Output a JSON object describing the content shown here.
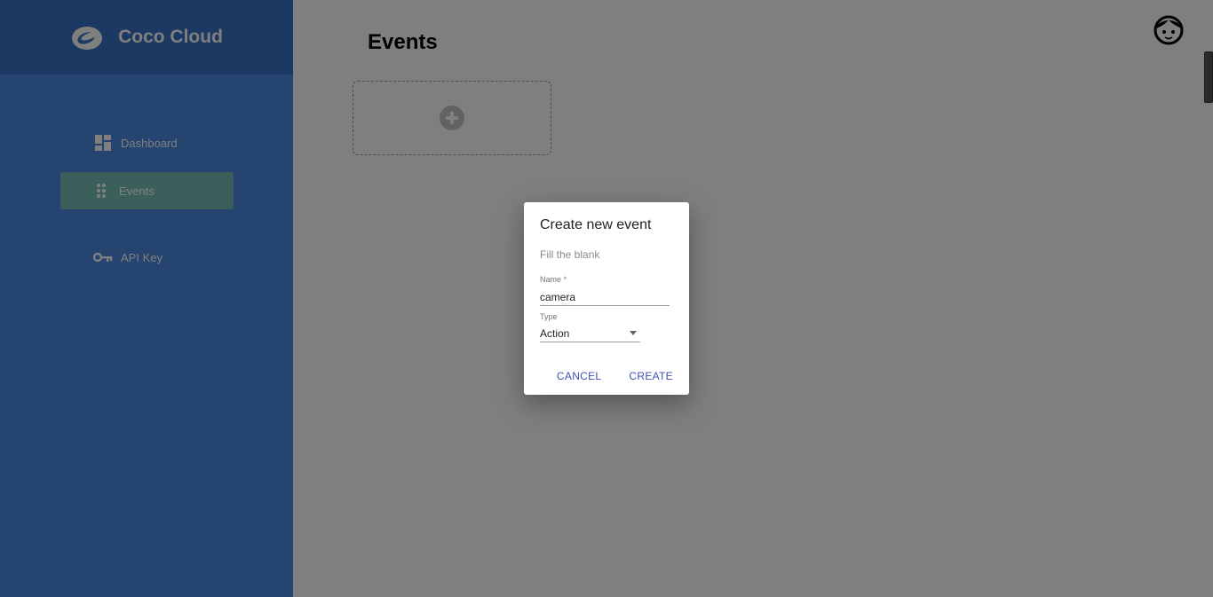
{
  "sidebar": {
    "brand": "Coco Cloud",
    "logo_icon": "cloud-logo-icon",
    "items": [
      {
        "label": "Dashboard",
        "icon": "dashboard-icon",
        "active": false
      },
      {
        "label": "Events",
        "icon": "drag-dots-icon",
        "active": true
      },
      {
        "label": "API Key",
        "icon": "key-icon",
        "active": false
      }
    ]
  },
  "main": {
    "title": "Events",
    "add_card_icon": "plus-circle-icon",
    "avatar_icon": "user-avatar-icon"
  },
  "dialog": {
    "title": "Create new event",
    "subtitle": "Fill the blank",
    "name_label": "Name *",
    "name_value": "camera",
    "type_label": "Type",
    "type_value": "Action",
    "cancel_label": "CANCEL",
    "create_label": "CREATE"
  },
  "colors": {
    "sidebar": "#4a8ae0",
    "sidebar_header": "#3673c7",
    "active_item": "#77c0b8",
    "primary_button": "#3f51b5"
  }
}
